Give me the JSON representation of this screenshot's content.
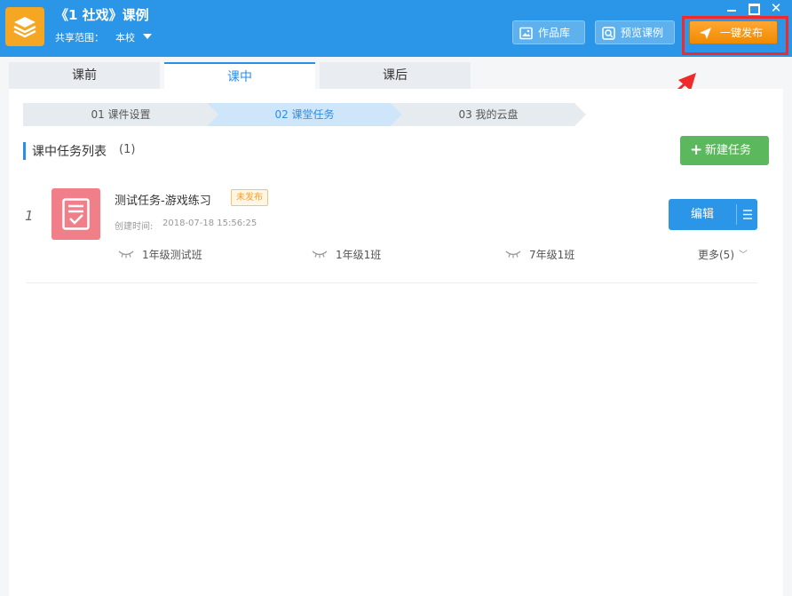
{
  "header": {
    "course_title": "《1 社戏》课例",
    "share_label": "共享范围：",
    "share_value": "本校",
    "buttons": {
      "library": "作品库",
      "preview": "预览课例",
      "publish": "一键发布"
    }
  },
  "tabs": [
    {
      "label": "课前"
    },
    {
      "label": "课中"
    },
    {
      "label": "课后"
    }
  ],
  "steps": [
    {
      "label": "01 课件设置"
    },
    {
      "label": "02 课堂任务"
    },
    {
      "label": "03 我的云盘"
    }
  ],
  "task_list": {
    "title": "课中任务列表",
    "count": "(1)",
    "new_button": "新建任务",
    "tasks": [
      {
        "index": "1",
        "name": "测试任务-游戏练习",
        "status": "未发布",
        "created_label": "创建时间:",
        "created_value": "2018-07-18 15:56:25",
        "classes": [
          "1年级测试班",
          "1年级1班",
          "7年级1班"
        ],
        "more": "更多(5)",
        "edit_button": "编辑"
      }
    ]
  },
  "colors": {
    "brand_blue": "#2b95e8",
    "publish_orange": "#f5a623",
    "new_green": "#5cb85c",
    "annotation_red": "#ee2a2a",
    "thumb_pink": "#f07f8a"
  }
}
